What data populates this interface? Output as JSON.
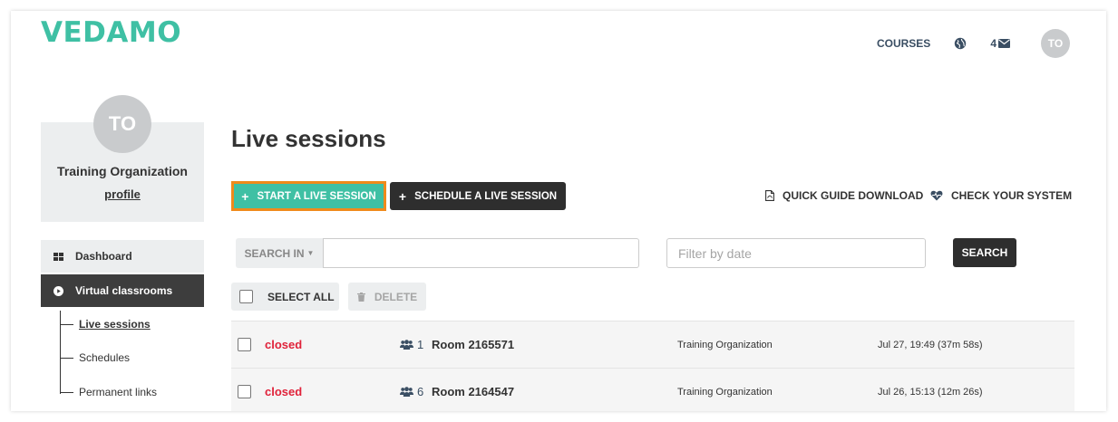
{
  "header": {
    "logo": "VEDAMO",
    "nav": {
      "courses": "COURSES",
      "message_count": "4",
      "avatar_initials": "TO"
    }
  },
  "sidebar": {
    "avatar_initials": "TO",
    "org_name": "Training Organization",
    "profile_link": "profile",
    "items": [
      {
        "label": "Dashboard",
        "icon": "grid-icon"
      },
      {
        "label": "Virtual classrooms",
        "icon": "play-circle-icon",
        "active": true
      }
    ],
    "subitems": [
      {
        "label": "Live sessions",
        "active": true
      },
      {
        "label": "Schedules"
      },
      {
        "label": "Permanent links"
      }
    ]
  },
  "main": {
    "title": "Live sessions",
    "start_button": "START A LIVE SESSION",
    "schedule_button": "SCHEDULE A LIVE SESSION",
    "quick_guide": "QUICK GUIDE DOWNLOAD",
    "check_system": "CHECK YOUR SYSTEM",
    "search_in": "SEARCH IN",
    "search_value": "",
    "date_placeholder": "Filter by date",
    "search_button": "SEARCH",
    "select_all": "SELECT ALL",
    "delete": "DELETE"
  },
  "sessions": [
    {
      "status": "closed",
      "participants": "1",
      "room": "Room 2165571",
      "org": "Training Organization",
      "time": "Jul 27, 19:49 (37m 58s)"
    },
    {
      "status": "closed",
      "participants": "6",
      "room": "Room 2164547",
      "org": "Training Organization",
      "time": "Jul 26, 15:13 (12m 26s)"
    }
  ],
  "colors": {
    "brand": "#3fc0a4",
    "highlight": "#f08a1b",
    "closed": "#e0223a",
    "dark": "#2e2e2e"
  }
}
